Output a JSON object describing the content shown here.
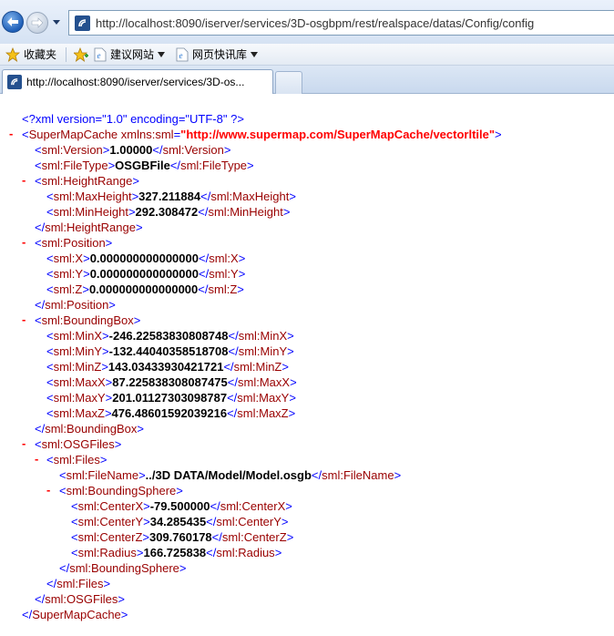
{
  "browser": {
    "address_url": "http://localhost:8090/iserver/services/3D-osgbpm/rest/realspace/datas/Config/config",
    "favorites_label": "收藏夹",
    "fav_links": [
      {
        "label": "建议网站"
      },
      {
        "label": "网页快讯库"
      }
    ],
    "tab_title": "http://localhost:8090/iserver/services/3D-os..."
  },
  "xml": {
    "declaration": "<?xml version=\"1.0\" encoding=\"UTF-8\" ?>",
    "root_open_tag": "SuperMapCache",
    "root_attr_name": "xmlns:sml",
    "root_attr_value": "http://www.supermap.com/SuperMapCache/vectorltile",
    "root_close_tag": "SuperMapCache",
    "toggle_symbol": "-",
    "version_tag": "sml:Version",
    "version_value": "1.00000",
    "filetype_tag": "sml:FileType",
    "filetype_value": "OSGBFile",
    "heightrange_tag": "sml:HeightRange",
    "maxheight_tag": "sml:MaxHeight",
    "maxheight_value": "327.211884",
    "minheight_tag": "sml:MinHeight",
    "minheight_value": "292.308472",
    "position_tag": "sml:Position",
    "x_tag": "sml:X",
    "x_value": "0.000000000000000",
    "y_tag": "sml:Y",
    "y_value": "0.000000000000000",
    "z_tag": "sml:Z",
    "z_value": "0.000000000000000",
    "boundingbox_tag": "sml:BoundingBox",
    "minx_tag": "sml:MinX",
    "minx_value": "-246.22583830808748",
    "miny_tag": "sml:MinY",
    "miny_value": "-132.44040358518708",
    "minz_tag": "sml:MinZ",
    "minz_value": "143.03433930421721",
    "maxx_tag": "sml:MaxX",
    "maxx_value": "87.225838308087475",
    "maxy_tag": "sml:MaxY",
    "maxy_value": "201.01127303098787",
    "maxz_tag": "sml:MaxZ",
    "maxz_value": "476.48601592039216",
    "osgfiles_tag": "sml:OSGFiles",
    "files_tag": "sml:Files",
    "filename_tag": "sml:FileName",
    "filename_value": "../3D DATA/Model/Model.osgb",
    "boundingsphere_tag": "sml:BoundingSphere",
    "centerx_tag": "sml:CenterX",
    "centerx_value": "-79.500000",
    "centery_tag": "sml:CenterY",
    "centery_value": "34.285435",
    "centerz_tag": "sml:CenterZ",
    "centerz_value": "309.760178",
    "radius_tag": "sml:Radius",
    "radius_value": "166.725838"
  },
  "colors": {
    "tag": "#990000",
    "bracket": "#0000ff",
    "attr_value": "#ff0000",
    "toggle": "#ff0000"
  }
}
